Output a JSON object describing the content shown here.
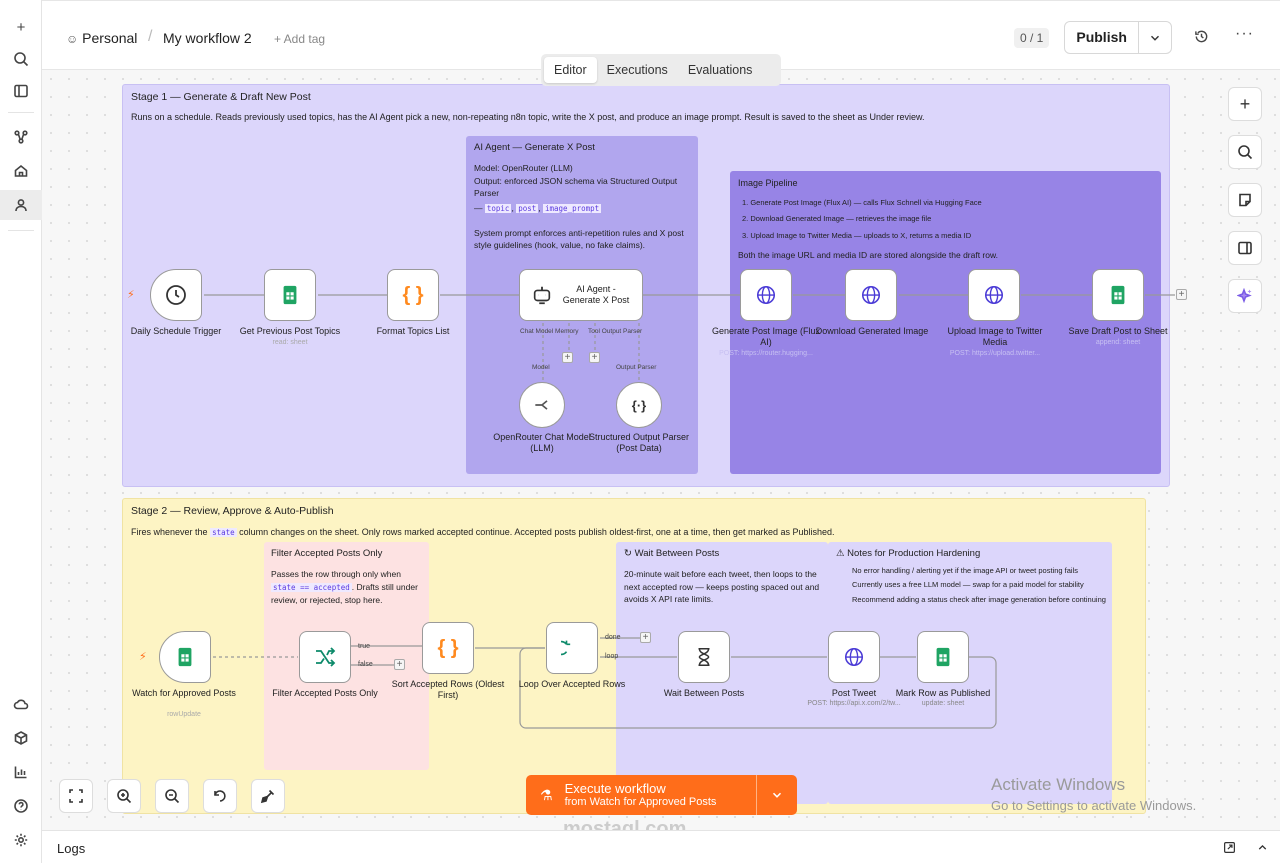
{
  "breadcrumb": {
    "project": "Personal",
    "workflow": "My workflow 2",
    "add_tag": "+ Add tag"
  },
  "header": {
    "counter": "0 / 1",
    "publish": "Publish"
  },
  "tabs": [
    "Editor",
    "Executions",
    "Evaluations"
  ],
  "stage1": {
    "title": "Stage 1 — Generate & Draft New Post",
    "desc": "Runs on a schedule. Reads previously used topics, has the AI Agent pick a new, non-repeating n8n topic, write the X post, and produce an image prompt. Result is saved to the sheet as Under review."
  },
  "ai_note": {
    "title": "AI Agent — Generate X Post",
    "model": "Model: OpenRouter (LLM)",
    "output": "Output: enforced JSON schema via Structured Output Parser",
    "dash": "—",
    "code1": "topic",
    "code2": "post",
    "code3": "image_prompt",
    "system": "System prompt enforces anti-repetition rules and X post style guidelines (hook, value, no fake claims)."
  },
  "image_note": {
    "title": "Image Pipeline",
    "items": [
      "1. Generate Post Image (Flux AI) — calls Flux Schnell via Hugging Face",
      "2. Download Generated Image — retrieves the image file",
      "3. Upload Image to Twitter Media — uploads to X, returns a media ID"
    ],
    "footer": "Both the image URL and media ID are stored alongside the draft row."
  },
  "stage2": {
    "title": "Stage 2 — Review, Approve & Auto-Publish",
    "desc_a": "Fires whenever the",
    "code": "state",
    "desc_b": "column changes on the sheet. Only rows marked accepted continue. Accepted posts publish oldest-first, one at a time, then get marked as Published."
  },
  "filter_note": {
    "title": "Filter Accepted Posts Only",
    "line1": "Passes the row through only when",
    "code": "state == accepted",
    "line2": ". Drafts still under review, or rejected, stop here."
  },
  "wait_note": {
    "title": "↻ Wait Between Posts",
    "body": "20-minute wait before each tweet, then loops to the next accepted row — keeps posting spaced out and avoids X API rate limits."
  },
  "prod_note": {
    "title": "⚠ Notes for Production Hardening",
    "items": [
      "No error handling / alerting yet if the image API or tweet posting fails",
      "Currently uses a free LLM model — swap for a paid model for stability",
      "Recommend adding a status check after image generation before continuing"
    ]
  },
  "nodes": {
    "schedule": {
      "label": "Daily Schedule Trigger"
    },
    "get_topics": {
      "label": "Get Previous Post Topics",
      "sub": "read: sheet"
    },
    "format": {
      "label": "Format Topics List"
    },
    "agent": {
      "label": "AI Agent - Generate X Post",
      "port1": "Chat Model Memory",
      "port2": "Tool Output Parser",
      "model": "Model",
      "parser": "Output Parser"
    },
    "openrouter": {
      "label": "OpenRouter Chat Model (LLM)"
    },
    "structured": {
      "label": "Structured Output Parser (Post Data)"
    },
    "gen_image": {
      "label": "Generate Post Image (Flux AI)",
      "sub": "POST: https://router.hugging..."
    },
    "download": {
      "label": "Download Generated Image"
    },
    "upload": {
      "label": "Upload Image to Twitter Media",
      "sub": "POST: https://upload.twitter..."
    },
    "save_draft": {
      "label": "Save Draft Post to Sheet",
      "sub": "append: sheet"
    },
    "watch": {
      "label": "Watch for Approved Posts",
      "sub": "rowUpdate"
    },
    "filter": {
      "label": "Filter Accepted Posts Only",
      "true": "true",
      "false": "false"
    },
    "sort": {
      "label": "Sort Accepted Rows (Oldest First)"
    },
    "loop": {
      "label": "Loop Over Accepted Rows",
      "done": "done",
      "loop": "loop"
    },
    "wait": {
      "label": "Wait Between Posts"
    },
    "tweet": {
      "label": "Post Tweet",
      "sub": "POST: https://api.x.com/2/tw..."
    },
    "mark": {
      "label": "Mark Row as Published",
      "sub": "update: sheet"
    }
  },
  "execute": {
    "line1": "Execute workflow",
    "line2": "from Watch for Approved Posts"
  },
  "logs": "Logs",
  "watermark": {
    "activate": "Activate Windows",
    "goto": "Go to Settings to activate Windows.",
    "site": "mostaql.com"
  },
  "colors": {
    "stage1": "#dcd6fb",
    "ai": "#b1a6ee",
    "image": "#9784e6",
    "stage2": "#fdf4c4",
    "filter": "#fde2e2",
    "wait": "#dcd6fb",
    "execute": "#ff6d1a"
  }
}
